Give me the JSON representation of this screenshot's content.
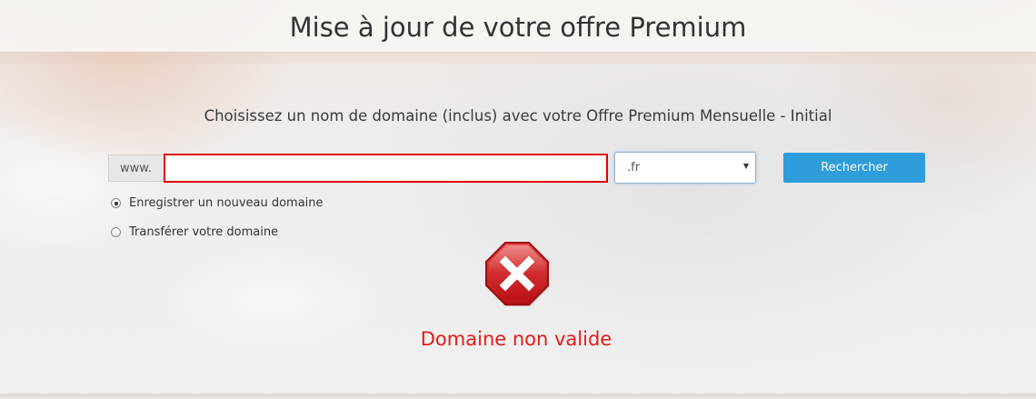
{
  "header": {
    "title": "Mise à jour de votre offre Premium"
  },
  "main": {
    "subtitle": "Choisissez un nom de domaine (inclus) avec votre Offre Premium Mensuelle - Initial",
    "domain_prefix": "www.",
    "domain_input": {
      "value": "",
      "placeholder": ""
    },
    "extension_select": {
      "selected": ".fr"
    },
    "search_label": "Rechercher",
    "options": [
      {
        "label": "Enregistrer un nouveau domaine",
        "checked": true
      },
      {
        "label": "Transférer votre domaine",
        "checked": false
      }
    ],
    "error": {
      "icon": "error-stop-icon",
      "message": "Domaine non valide"
    }
  },
  "colors": {
    "error_red": "#e31b1b",
    "input_error_border": "#e00000",
    "button_blue": "#2e9ddc"
  }
}
